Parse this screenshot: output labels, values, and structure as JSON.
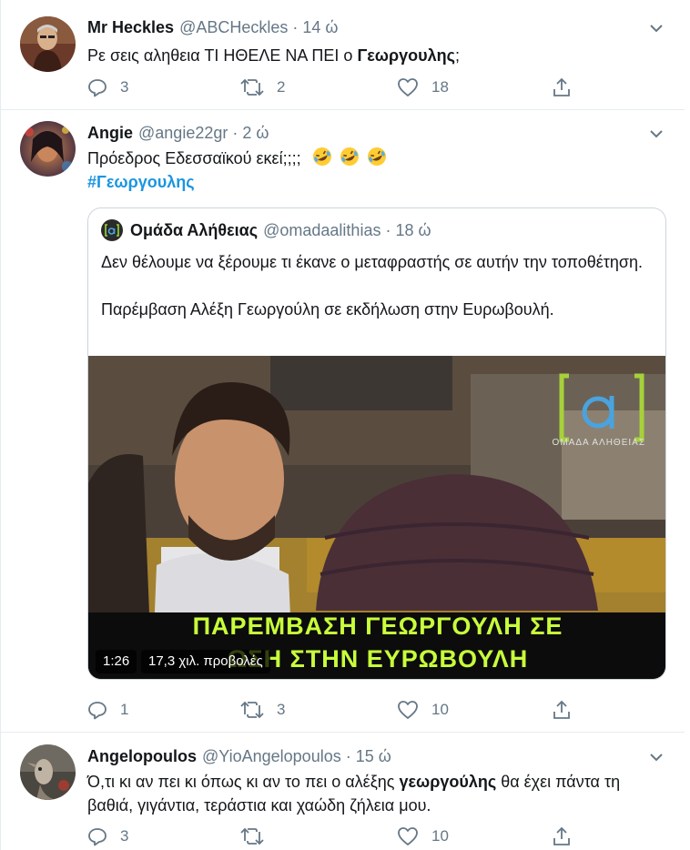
{
  "tweets": [
    {
      "name": "Mr Heckles",
      "handle": "@ABCHeckles",
      "dot": "·",
      "time": "14 ώ",
      "text_plain": "Ρε σεις αληθεια ΤΙ ΗΘΕΛΕ ΝΑ ΠΕΙ ο ",
      "text_bold": "Γεωργουλης",
      "text_after": ";",
      "replies": "3",
      "retweets": "2",
      "likes": "18"
    },
    {
      "name": "Angie",
      "handle": "@angie22gr",
      "dot": "·",
      "time": "2 ώ",
      "text_plain": "Πρόεδρος Εδεσσαϊκού εκεί;;;; ",
      "hashtag": "#Γεωργουλης",
      "replies": "1",
      "retweets": "3",
      "likes": "10",
      "quote": {
        "name": "Ομάδα Αλήθειας",
        "handle": "@omadaalithias",
        "dot": "·",
        "time": "18 ώ",
        "para1": "Δεν θέλουμε να ξέρουμε τι έκανε ο μεταφραστής σε αυτήν την τοποθέτηση.",
        "para2": "Παρέμβαση Αλέξη Γεωργούλη σε εκδήλωση στην Ευρωβουλή.",
        "video": {
          "caption_line1": "ΠΑΡΕΜΒΑΣΗ ΓΕΩΡΓΟΥΛΗ ΣΕ",
          "caption_line2": "ΩΣΗ ΣΤΗΝ ΕΥΡΩΒΟΥΛΗ",
          "duration": "1:26",
          "views": "17,3 χιλ. προβολές",
          "logo_text": "ΟΜΑΔΑ ΑΛΗΘΕΙΑΣ",
          "logo_glyph": "[α]"
        }
      }
    },
    {
      "name": "Angelopoulos",
      "handle": "@YioAngelopoulos",
      "dot": "·",
      "time": "15 ώ",
      "text_plain": "Ό,τι κι αν πει κι όπως κι αν το πει ο αλέξης ",
      "text_bold": "γεωργούλης",
      "text_after": " θα έχει πάντα τη βαθιά, γιγάντια, τεράστια και χαώδη ζήλεια μου.",
      "replies": "3",
      "retweets": "",
      "likes": "10"
    }
  ],
  "colors": {
    "link": "#1b95e0",
    "muted": "#657786",
    "border": "#e6ecf0",
    "caption": "#c8ff3a"
  },
  "icons": {
    "reply": "reply-icon",
    "retweet": "retweet-icon",
    "like": "heart-icon",
    "share": "share-icon",
    "more": "chevron-down-icon",
    "emoji": "rolling-on-floor-laughing-emoji"
  }
}
